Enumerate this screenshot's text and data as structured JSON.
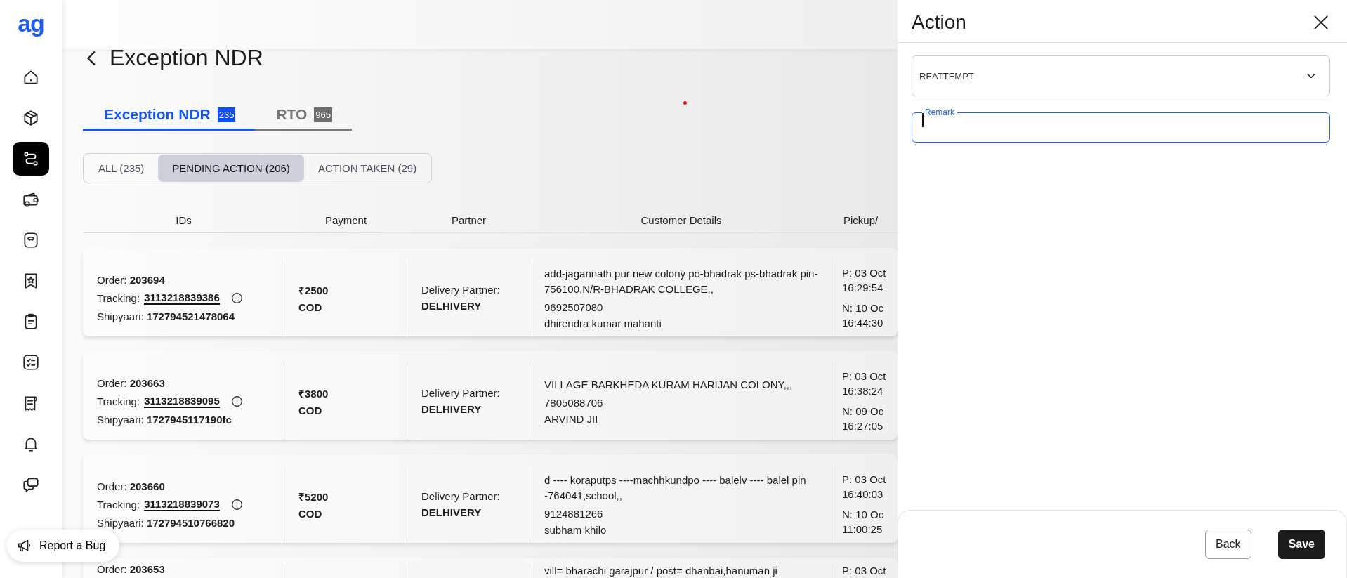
{
  "sidebar": {
    "logo": "ag",
    "items": [
      {
        "kind": "home",
        "selected": false
      },
      {
        "kind": "box",
        "selected": false
      },
      {
        "kind": "route",
        "selected": true
      },
      {
        "kind": "wallet",
        "selected": false
      },
      {
        "kind": "scale",
        "selected": false
      },
      {
        "kind": "badge",
        "selected": false
      },
      {
        "kind": "clipboard",
        "selected": false
      },
      {
        "kind": "checklist",
        "selected": false
      },
      {
        "kind": "receipt",
        "selected": false
      },
      {
        "kind": "bell",
        "selected": false
      },
      {
        "kind": "chat",
        "selected": false
      }
    ]
  },
  "page": {
    "title": "Exception NDR"
  },
  "tabs": [
    {
      "label": "Exception NDR",
      "count": "235",
      "selected": true
    },
    {
      "label": "RTO",
      "count": "965",
      "selected": false
    }
  ],
  "filters": [
    {
      "label": "ALL (235)",
      "selected": false
    },
    {
      "label": "PENDING ACTION (206)",
      "selected": true
    },
    {
      "label": "ACTION TAKEN (29)",
      "selected": false
    }
  ],
  "table": {
    "columns": [
      "IDs",
      "Payment",
      "Partner",
      "Customer Details",
      "Pickup/"
    ],
    "rows": [
      {
        "order_label": "Order:",
        "order": "203694",
        "tracking_label": "Tracking:",
        "tracking": "3113218839386",
        "shipyaari_label": "Shipyaari:",
        "shipyaari": "172794521478064",
        "amount": "₹2500",
        "mode": "COD",
        "partner_label": "Delivery Partner:",
        "partner": "DELHIVERY",
        "address": "add-jagannath pur new colony po-bhadrak ps-bhadrak pin-756100,N/R-BHADRAK COLLEGE,,",
        "phone": "9692507080",
        "name": "dhirendra kumar mahanti",
        "pickup_date": "P: 03 Oct",
        "pickup_time": "16:29:54",
        "ndr_date": "N: 10 Oc",
        "ndr_time": "16:44:30"
      },
      {
        "order_label": "Order:",
        "order": "203663",
        "tracking_label": "Tracking:",
        "tracking": "3113218839095",
        "shipyaari_label": "Shipyaari:",
        "shipyaari": "1727945117190fc",
        "amount": "₹3800",
        "mode": "COD",
        "partner_label": "Delivery Partner:",
        "partner": "DELHIVERY",
        "address": "VILLAGE BARKHEDA KURAM HARIJAN COLONY,,,",
        "phone": "7805088706",
        "name": "ARVIND JII",
        "pickup_date": "P: 03 Oct",
        "pickup_time": "16:38:24",
        "ndr_date": "N: 09 Oc",
        "ndr_time": "16:27:05"
      },
      {
        "order_label": "Order:",
        "order": "203660",
        "tracking_label": "Tracking:",
        "tracking": "3113218839073",
        "shipyaari_label": "Shipyaari:",
        "shipyaari": "172794510766820",
        "amount": "₹5200",
        "mode": "COD",
        "partner_label": "Delivery Partner:",
        "partner": "DELHIVERY",
        "address": "d ---- koraputps ----machhkundpo ---- balelv ---- balel pin -764041,school,,",
        "phone": "9124881266",
        "name": "subham khilo",
        "pickup_date": "P: 03 Oct",
        "pickup_time": "16:40:03",
        "ndr_date": "N: 10 Oc",
        "ndr_time": "11:00:25"
      },
      {
        "order_label": "Order:",
        "order": "203653",
        "address": "vill= bharachi garajpur / post= dhanbai,hanuman ji",
        "pickup_date": "P: 03 Oct"
      }
    ]
  },
  "report_bug": {
    "label": "Report a Bug"
  },
  "panel": {
    "title": "Action",
    "select_value": "REATTEMPT",
    "remark": {
      "label": "Remark",
      "focused": true
    },
    "buttons": [
      {
        "label": "Back",
        "kind": "secondary"
      },
      {
        "label": "Save",
        "kind": "primary"
      }
    ]
  }
}
